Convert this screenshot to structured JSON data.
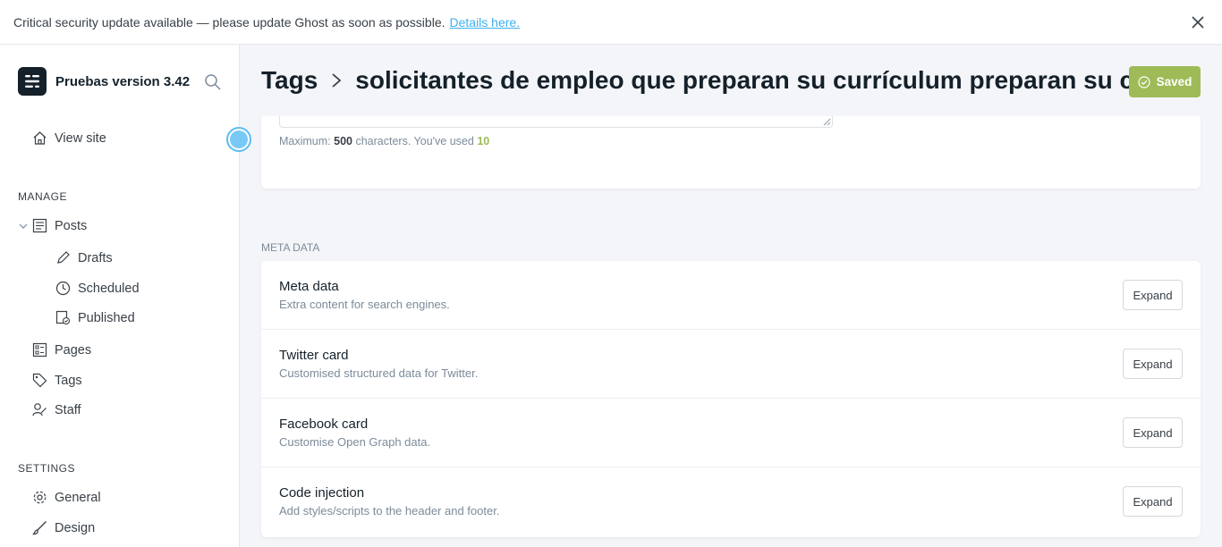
{
  "banner": {
    "message": "Critical security update available — please update Ghost as soon as possible.",
    "link": "Details here."
  },
  "sidebar": {
    "site_name": "Pruebas version 3.42",
    "view_site": "View site",
    "manage_title": "MANAGE",
    "posts": "Posts",
    "drafts": "Drafts",
    "scheduled": "Scheduled",
    "published": "Published",
    "pages": "Pages",
    "tags": "Tags",
    "staff": "Staff",
    "settings_title": "SETTINGS",
    "general": "General",
    "design": "Design"
  },
  "header": {
    "crumb_root": "Tags",
    "crumb_current": "solicitantes de empleo que preparan su currículum preparan su currículum",
    "saved": "Saved"
  },
  "description": {
    "max_label": "Maximum:",
    "max_value": "500",
    "used_label": "characters. You've used",
    "used_value": "10"
  },
  "meta": {
    "section_label": "META DATA",
    "expand_label": "Expand",
    "rows": [
      {
        "title": "Meta data",
        "desc": "Extra content for search engines."
      },
      {
        "title": "Twitter card",
        "desc": "Customised structured data for Twitter."
      },
      {
        "title": "Facebook card",
        "desc": "Customise Open Graph data."
      },
      {
        "title": "Code injection",
        "desc": "Add styles/scripts to the header and footer."
      }
    ]
  },
  "colors": {
    "accent_green": "#9fbb58",
    "link_blue": "#3eb0ef",
    "dark": "#15212a"
  }
}
